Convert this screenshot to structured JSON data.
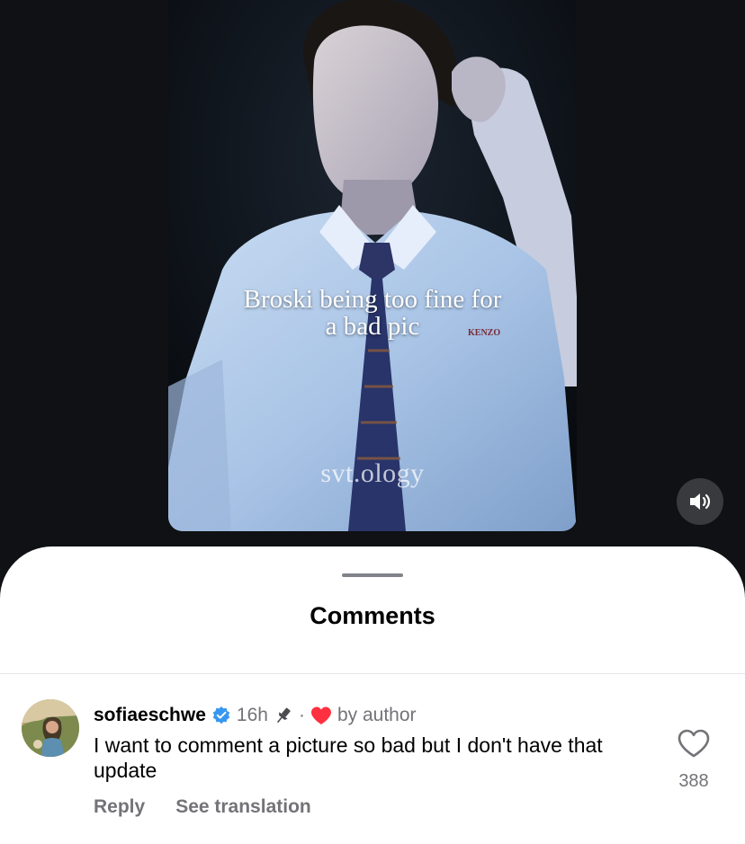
{
  "video": {
    "caption_line1": "Broski being too fine for",
    "caption_line2": "a bad pic",
    "watermark": "svt.ology",
    "shirt_brand": "KENZO",
    "sound_icon": "speaker-on-icon"
  },
  "sheet": {
    "title": "Comments"
  },
  "comment": {
    "username": "sofiaeschwe",
    "verified_icon": "verified-badge-icon",
    "time": "16h",
    "pinned_icon": "pin-icon",
    "separator": "·",
    "liked_by_author_icon": "red-heart-icon",
    "liked_by_author_label": "by author",
    "text": "I want to comment a picture so bad but I don't have that update",
    "reply_label": "Reply",
    "translate_label": "See translation",
    "like_icon": "heart-outline-icon",
    "like_count": "388"
  },
  "colors": {
    "background": "#0f1114",
    "sheet": "#ffffff",
    "verified": "#3797f0",
    "author_heart": "#ff3040",
    "secondary_text": "#737378"
  }
}
